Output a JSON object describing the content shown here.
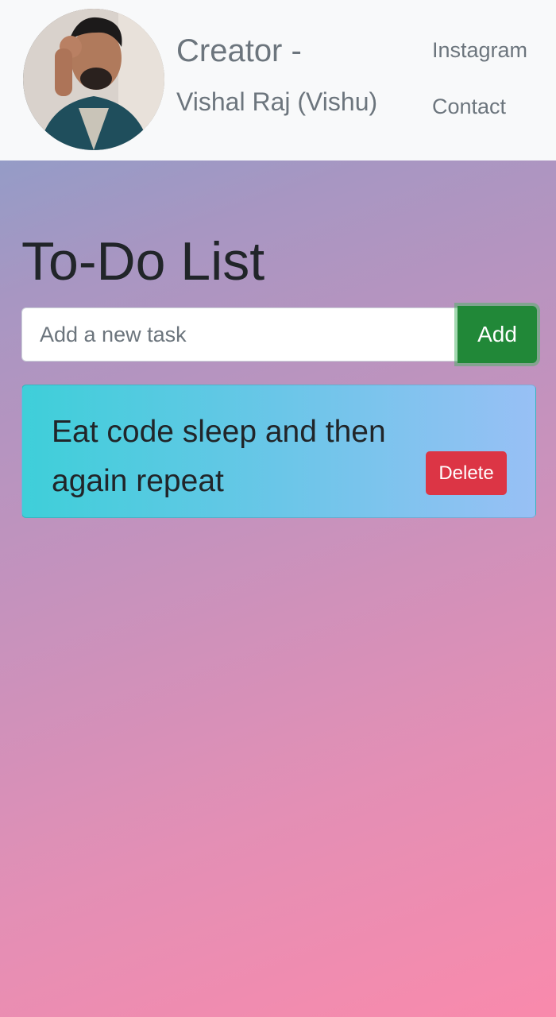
{
  "navbar": {
    "creator_title": "Creator -",
    "creator_name": "Vishal Raj (Vishu)",
    "links": [
      {
        "label": "Instagram"
      },
      {
        "label": "Contact"
      }
    ]
  },
  "main": {
    "heading": "To-Do List",
    "task_input": {
      "value": "",
      "placeholder": "Add a new task"
    },
    "add_button_label": "Add",
    "tasks": [
      {
        "text": "Eat code sleep and then again repeat",
        "delete_label": "Delete"
      }
    ]
  },
  "colors": {
    "add_button": "#218838",
    "delete_button": "#dc3545",
    "navbar_bg": "#f8f9fa"
  }
}
